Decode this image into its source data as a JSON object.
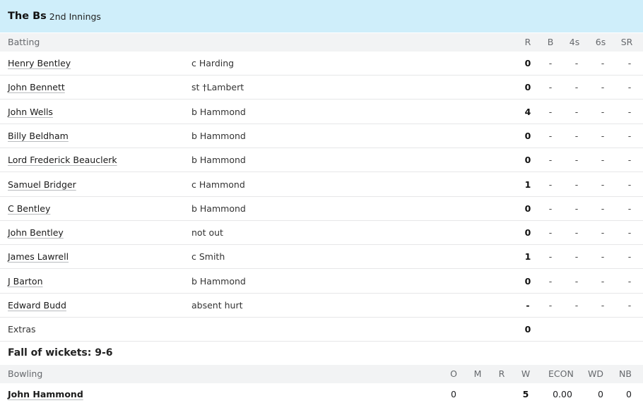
{
  "innings": {
    "team": "The Bs",
    "label": "2nd Innings"
  },
  "batting": {
    "headers": {
      "section": "Batting",
      "r": "R",
      "b": "B",
      "fours": "4s",
      "sixes": "6s",
      "sr": "SR"
    },
    "rows": [
      {
        "name": "Henry Bentley",
        "dismissal": "c Harding",
        "r": "0",
        "b": "-",
        "fours": "-",
        "sixes": "-",
        "sr": "-"
      },
      {
        "name": "John Bennett",
        "dismissal": "st †Lambert",
        "r": "0",
        "b": "-",
        "fours": "-",
        "sixes": "-",
        "sr": "-"
      },
      {
        "name": "John Wells",
        "dismissal": "b Hammond",
        "r": "4",
        "b": "-",
        "fours": "-",
        "sixes": "-",
        "sr": "-"
      },
      {
        "name": "Billy Beldham",
        "dismissal": "b Hammond",
        "r": "0",
        "b": "-",
        "fours": "-",
        "sixes": "-",
        "sr": "-"
      },
      {
        "name": "Lord Frederick Beauclerk",
        "dismissal": "b Hammond",
        "r": "0",
        "b": "-",
        "fours": "-",
        "sixes": "-",
        "sr": "-"
      },
      {
        "name": "Samuel Bridger",
        "dismissal": "c Hammond",
        "r": "1",
        "b": "-",
        "fours": "-",
        "sixes": "-",
        "sr": "-"
      },
      {
        "name": "C Bentley",
        "dismissal": "b Hammond",
        "r": "0",
        "b": "-",
        "fours": "-",
        "sixes": "-",
        "sr": "-"
      },
      {
        "name": "John Bentley",
        "dismissal": "not out",
        "r": "0",
        "b": "-",
        "fours": "-",
        "sixes": "-",
        "sr": "-"
      },
      {
        "name": "James Lawrell",
        "dismissal": "c Smith",
        "r": "1",
        "b": "-",
        "fours": "-",
        "sixes": "-",
        "sr": "-"
      },
      {
        "name": "J Barton",
        "dismissal": "b Hammond",
        "r": "0",
        "b": "-",
        "fours": "-",
        "sixes": "-",
        "sr": "-"
      },
      {
        "name": "Edward Budd",
        "dismissal": "absent hurt",
        "r": "-",
        "b": "-",
        "fours": "-",
        "sixes": "-",
        "sr": "-"
      }
    ],
    "extras": {
      "label": "Extras",
      "value": "0"
    }
  },
  "fall_of_wickets": "Fall of wickets: 9-6",
  "bowling": {
    "headers": {
      "section": "Bowling",
      "o": "O",
      "m": "M",
      "r": "R",
      "w": "W",
      "econ": "ECON",
      "wd": "WD",
      "nb": "NB"
    },
    "rows": [
      {
        "name": "John Hammond",
        "o": "0",
        "m": "",
        "r": "",
        "w": "5",
        "econ": "0.00",
        "wd": "0",
        "nb": "0"
      }
    ]
  }
}
